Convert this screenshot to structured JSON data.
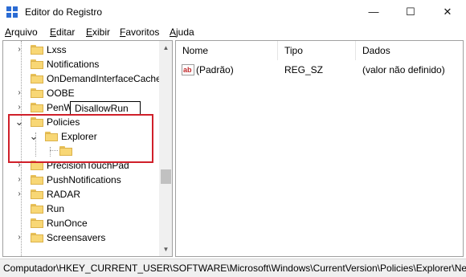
{
  "window": {
    "title": "Editor do Registro",
    "minimize_glyph": "—",
    "maximize_glyph": "☐",
    "close_glyph": "✕"
  },
  "menu": [
    {
      "label": "Arquivo",
      "accel": "A",
      "rest": "rquivo"
    },
    {
      "label": "Editar",
      "accel": "E",
      "rest": "ditar"
    },
    {
      "label": "Exibir",
      "accel": "E",
      "rest": "xibir"
    },
    {
      "label": "Favoritos",
      "accel": "F",
      "rest": "avoritos"
    },
    {
      "label": "Ajuda",
      "accel": "A",
      "rest": "juda"
    }
  ],
  "tree": {
    "items": [
      {
        "label": "Lxss",
        "expandable": true,
        "expanded": false
      },
      {
        "label": "Notifications",
        "expandable": false,
        "expanded": false
      },
      {
        "label": "OnDemandInterfaceCache",
        "expandable": false,
        "expanded": false
      },
      {
        "label": "OOBE",
        "expandable": true,
        "expanded": false
      },
      {
        "label": "PenWorkspace",
        "expandable": true,
        "expanded": false
      },
      {
        "label": "Policies",
        "expandable": true,
        "expanded": true
      },
      {
        "label": "Explorer",
        "expandable": true,
        "expanded": true
      },
      {
        "label": "DisallowRun",
        "editing": true
      },
      {
        "label": "PrecisionTouchPad",
        "expandable": true,
        "expanded": false
      },
      {
        "label": "PushNotifications",
        "expandable": true,
        "expanded": false
      },
      {
        "label": "RADAR",
        "expandable": true,
        "expanded": false
      },
      {
        "label": "Run",
        "expandable": false,
        "expanded": false
      },
      {
        "label": "RunOnce",
        "expandable": false,
        "expanded": false
      },
      {
        "label": "Screensavers",
        "expandable": true,
        "expanded": false
      }
    ],
    "collapsed_glyph": "›",
    "expanded_glyph": "⌄"
  },
  "values": {
    "columns": [
      "Nome",
      "Tipo",
      "Dados"
    ],
    "rows": [
      {
        "name": "(Padrão)",
        "type": "REG_SZ",
        "data": "(valor não definido)",
        "icon": "string-value-icon"
      }
    ]
  },
  "status": {
    "path": "Computador\\HKEY_CURRENT_USER\\SOFTWARE\\Microsoft\\Windows\\CurrentVersion\\Policies\\Explorer\\Ne"
  },
  "colors": {
    "highlight_box": "#d0202a",
    "folder": "#f8d775"
  }
}
